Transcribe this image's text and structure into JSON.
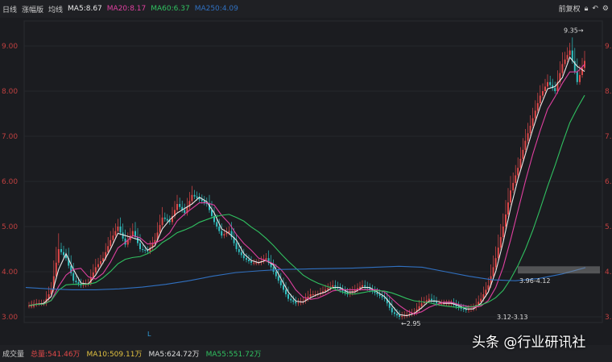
{
  "header": {
    "period": "日线",
    "overlay": "涨幅版",
    "ma_toggle": "均线",
    "ma5": "MA5:8.67",
    "ma20": "MA20:8.17",
    "ma60": "MA60:6.37",
    "ma250": "MA250:4.09",
    "adjust": "前复权"
  },
  "footer": {
    "label": "成交量",
    "total": "总量:541.46万",
    "ma10": "MA10:509.11万",
    "ma5": "MA5:624.72万",
    "ma55": "MA55:551.72万"
  },
  "watermark": "头条 @行业研讯社",
  "colors": {
    "ma5": "#e8e8e8",
    "ma20": "#e040a0",
    "ma60": "#30c060",
    "ma250": "#3070c0",
    "up": "#e04848",
    "down": "#30c0c0"
  },
  "chart_data": {
    "type": "candlestick",
    "ylim": [
      2.8,
      9.6
    ],
    "y_ticks": [
      "3.00",
      "4.00",
      "5.00",
      "6.00",
      "7.00",
      "8.00",
      "9.00"
    ],
    "right_ticks": [
      "3.",
      "4.",
      "5.",
      "6.",
      "7.",
      "8.",
      "9."
    ],
    "annotations": {
      "high": "9.35",
      "low": "2.95",
      "range1": "3.96-4.12",
      "range2": "3.12-3.13",
      "marker": "L"
    },
    "closes": [
      3.25,
      3.3,
      3.3,
      3.6,
      4.5,
      4.3,
      3.8,
      3.7,
      3.75,
      4.1,
      4.3,
      4.7,
      5.0,
      4.6,
      4.9,
      4.5,
      4.45,
      4.7,
      5.2,
      5.1,
      5.5,
      5.3,
      5.7,
      5.6,
      5.5,
      5.1,
      4.8,
      4.9,
      4.5,
      4.3,
      4.2,
      4.2,
      4.3,
      4.0,
      3.7,
      3.4,
      3.3,
      3.35,
      3.5,
      3.5,
      3.6,
      3.7,
      3.6,
      3.5,
      3.6,
      3.7,
      3.6,
      3.5,
      3.4,
      3.1,
      3.0,
      3.05,
      3.1,
      3.3,
      3.4,
      3.3,
      3.3,
      3.3,
      3.2,
      3.15,
      3.2,
      3.4,
      3.7,
      4.3,
      5.0,
      5.8,
      6.3,
      6.9,
      7.4,
      7.9,
      8.2,
      8.0,
      8.6,
      8.9,
      8.2,
      8.67
    ],
    "ma250": [
      3.65,
      3.62,
      3.6,
      3.6,
      3.62,
      3.66,
      3.72,
      3.8,
      3.9,
      3.98,
      4.02,
      4.05,
      4.06,
      4.07,
      4.08,
      4.1,
      4.12,
      4.1,
      4.0,
      3.9,
      3.82,
      3.8,
      3.85,
      3.95,
      4.09
    ]
  }
}
